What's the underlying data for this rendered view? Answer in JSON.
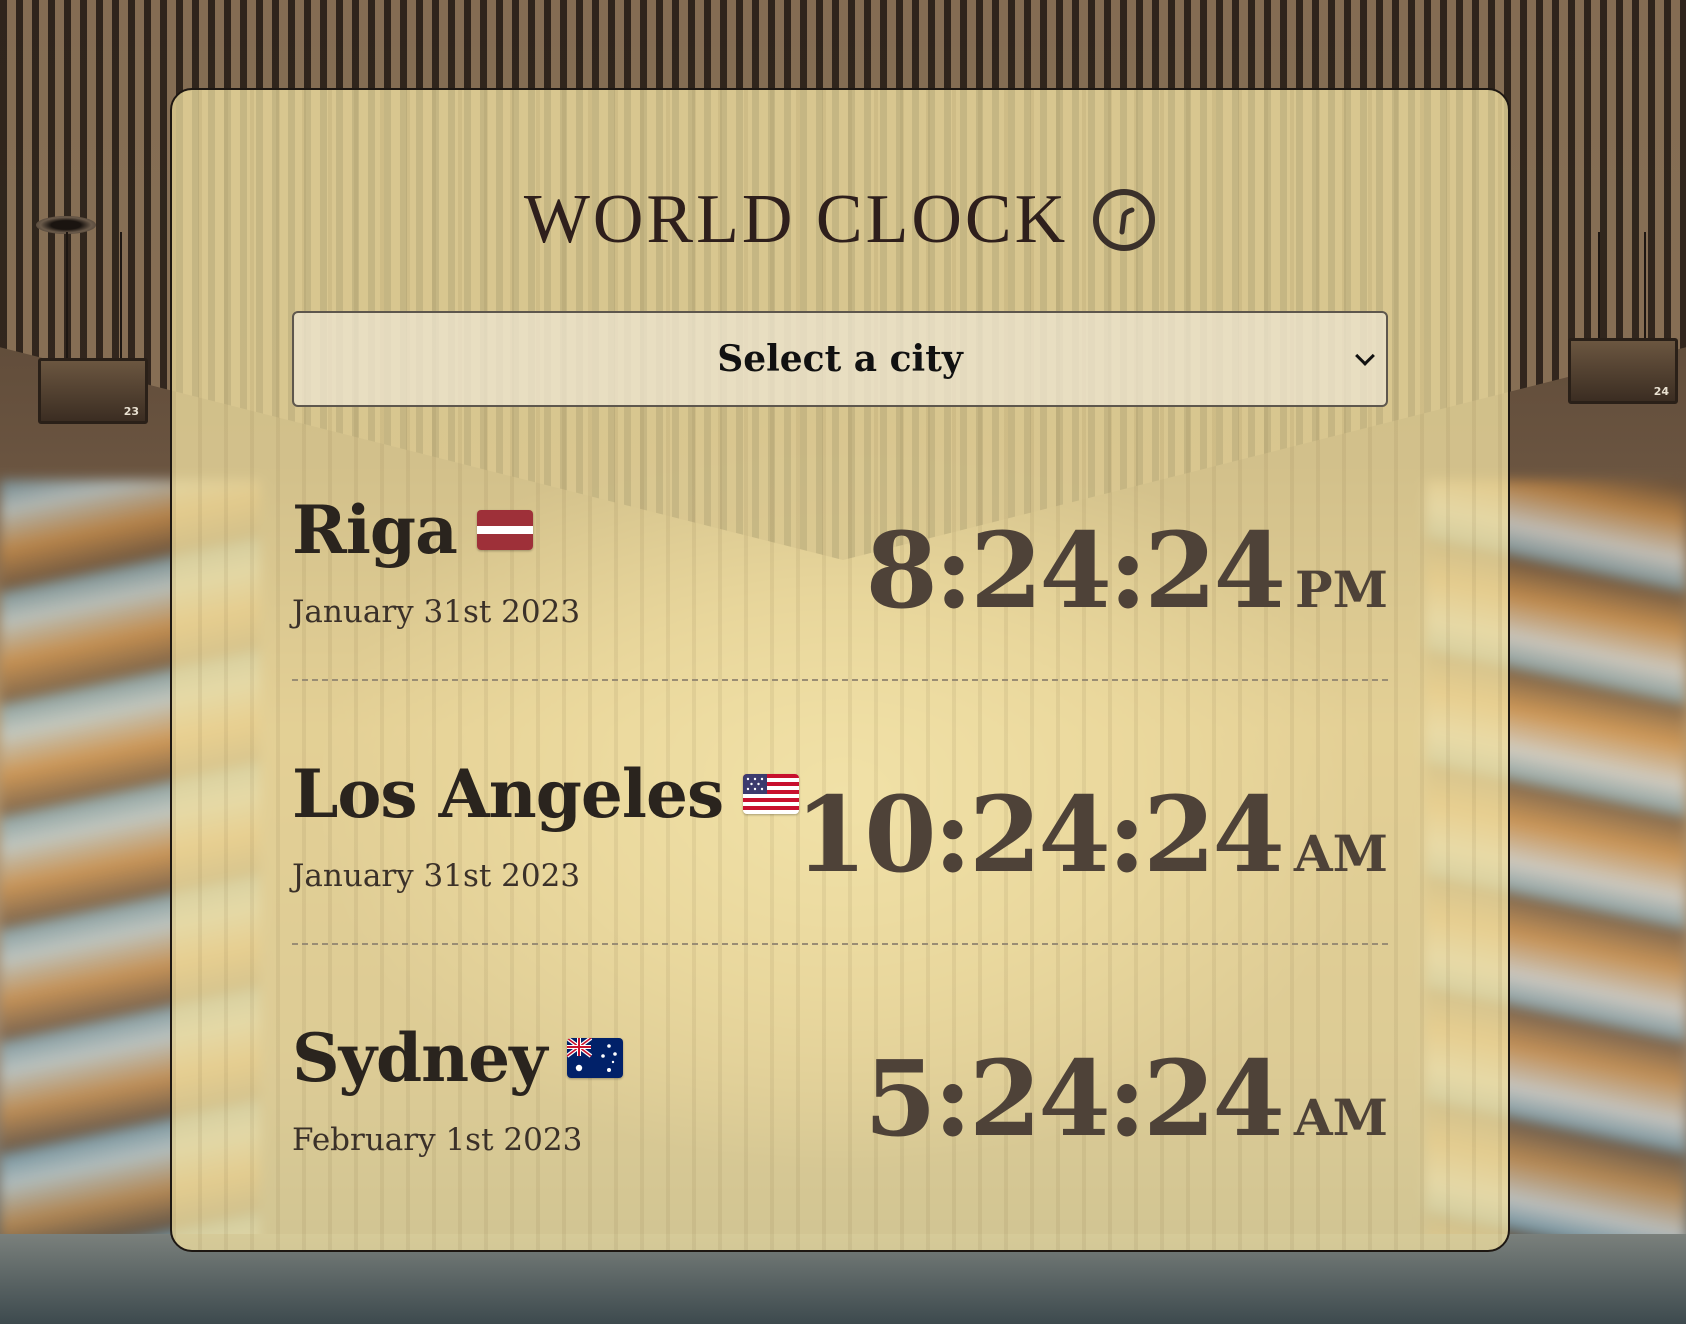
{
  "app": {
    "title": "WORLD CLOCK",
    "title_icon": "clock-icon"
  },
  "city_select": {
    "label": "Select a city",
    "icon": "chevron-down-icon"
  },
  "cities": [
    {
      "name": "Riga",
      "flag": "latvia-flag-icon",
      "date": "January 31st 2023",
      "time": "8:24:24",
      "ampm": "PM"
    },
    {
      "name": "Los Angeles",
      "flag": "usa-flag-icon",
      "date": "January 31st 2023",
      "time": "10:24:24",
      "ampm": "AM"
    },
    {
      "name": "Sydney",
      "flag": "australia-flag-icon",
      "date": "February 1st 2023",
      "time": "5:24:24",
      "ampm": "AM"
    }
  ],
  "colors": {
    "card_background": "#f0dfa0",
    "title_text": "#2e1f1c",
    "time_text": "#4e4238",
    "city_text": "#2a241e"
  },
  "background": {
    "platform_signs": [
      "23",
      "24"
    ]
  }
}
